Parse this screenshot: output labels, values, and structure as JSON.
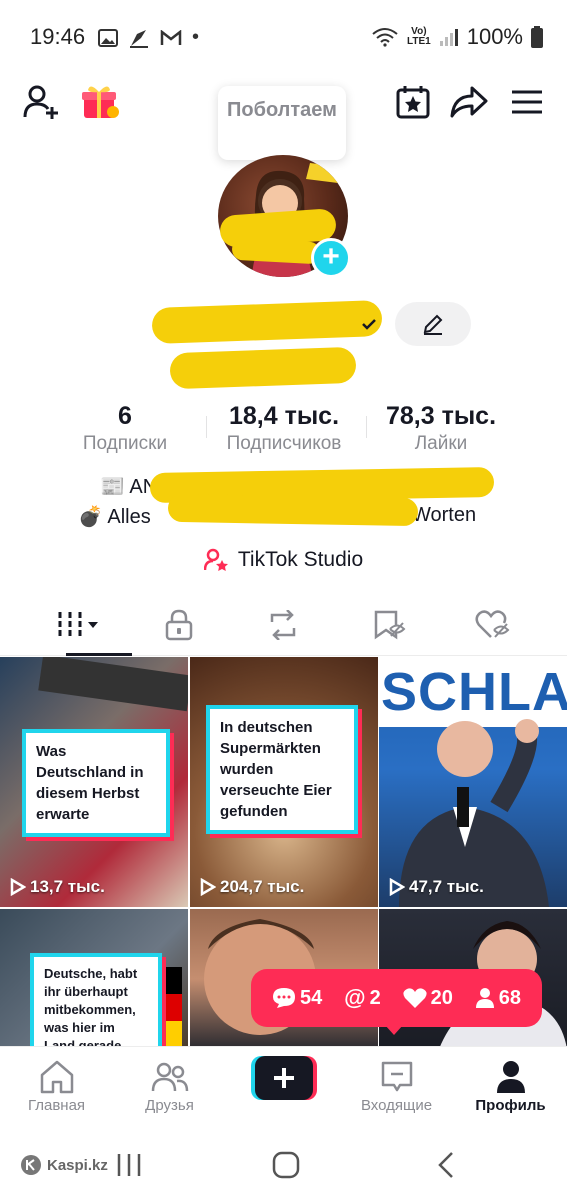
{
  "status_bar": {
    "time": "19:46",
    "network_top": "Vo)",
    "network_bottom": "LTE1",
    "battery": "100%"
  },
  "tooltip": {
    "text": "Поболтаем"
  },
  "stats": [
    {
      "value": "6",
      "label": "Подписки"
    },
    {
      "value": "18,4 тыс.",
      "label": "Подписчиков"
    },
    {
      "value": "78,3 тыс.",
      "label": "Лайки"
    }
  ],
  "bio": {
    "line1_prefix": "ANA",
    "line2_prefix": "Alles",
    "line2_suffix": "Worten"
  },
  "studio": {
    "label": "TikTok Studio"
  },
  "videos": [
    {
      "text": "Was Deutschland in diesem Herbst erwarte",
      "views": "13,7 тыс."
    },
    {
      "text": "In deutschen Supermärkten wurden verseuchte Eier gefunden",
      "views": "204,7 тыс."
    },
    {
      "overlay_text": "SCHLA",
      "views": "47,7 тыс."
    },
    {
      "text": "Deutsche, habt ihr überhaupt mitbekommen, was hier im Land gerade",
      "views": ""
    },
    {
      "text": "",
      "views": ""
    },
    {
      "text": "",
      "views": ""
    }
  ],
  "notifications": {
    "comments": "54",
    "mentions": "2",
    "likes": "20",
    "followers": "68"
  },
  "bottom_nav": {
    "home": "Главная",
    "friends": "Друзья",
    "inbox": "Входящие",
    "profile": "Профиль"
  },
  "system": {
    "watermark": "Kaspi.kz"
  },
  "colors": {
    "accent": "#fe2c55",
    "cyan": "#20d5ec",
    "scribble": "#f5cf0a"
  }
}
